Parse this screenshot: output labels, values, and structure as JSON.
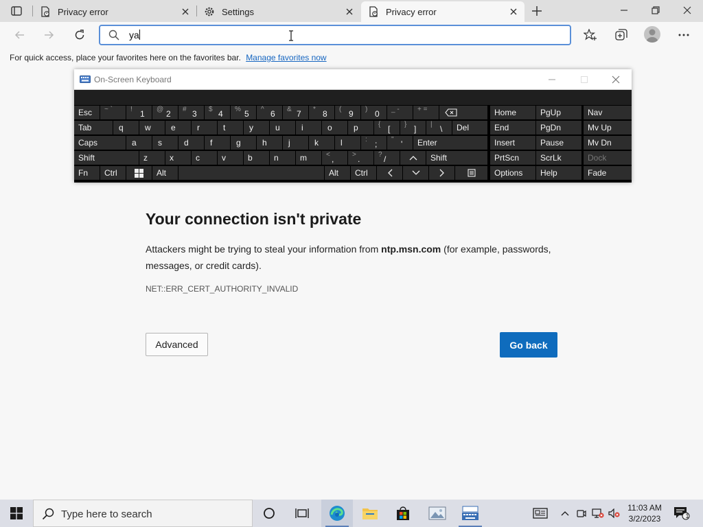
{
  "browser": {
    "tabs": [
      {
        "title": "Privacy error",
        "icon": "page-warning-icon",
        "active": false
      },
      {
        "title": "Settings",
        "icon": "gear-icon",
        "active": false
      },
      {
        "title": "Privacy error",
        "icon": "page-warning-icon",
        "active": true
      }
    ],
    "address_bar": {
      "value": "ya"
    },
    "favorites_bar": {
      "message": "For quick access, place your favorites here on the favorites bar.",
      "link": "Manage favorites now"
    }
  },
  "page": {
    "title": "Your connection isn't private",
    "description_before": "Attackers might be trying to steal your information from ",
    "host": "ntp.msn.com",
    "description_after": " (for example, passwords, messages, or credit cards).",
    "error_code": "NET::ERR_CERT_AUTHORITY_INVALID",
    "advanced_button": "Advanced",
    "back_button": "Go back"
  },
  "osk": {
    "title": "On-Screen Keyboard",
    "keys": {
      "esc": "Esc",
      "tab": "Tab",
      "caps": "Caps",
      "shift": "Shift",
      "fn": "Fn",
      "ctrl": "Ctrl",
      "alt": "Alt",
      "del": "Del",
      "enter": "Enter",
      "home": "Home",
      "pgup": "PgUp",
      "nav": "Nav",
      "end": "End",
      "pgdn": "PgDn",
      "mvup": "Mv Up",
      "insert": "Insert",
      "pause": "Pause",
      "mvdn": "Mv Dn",
      "prtscn": "PrtScn",
      "scrlk": "ScrLk",
      "dock": "Dock",
      "options": "Options",
      "help": "Help",
      "fade": "Fade"
    },
    "row1": [
      [
        "~ `",
        "",
        ""
      ],
      [
        "!",
        "1",
        ""
      ],
      [
        "@",
        "2",
        ""
      ],
      [
        "#",
        "3",
        ""
      ],
      [
        "$",
        "4",
        ""
      ],
      [
        "%",
        "5",
        ""
      ],
      [
        "^",
        "6",
        ""
      ],
      [
        "&",
        "7",
        ""
      ],
      [
        "*",
        "8",
        ""
      ],
      [
        "(",
        "9",
        ""
      ],
      [
        ")",
        "0",
        ""
      ],
      [
        "_ -",
        "",
        ""
      ],
      [
        "+ =",
        "",
        ""
      ]
    ],
    "row2": [
      "q",
      "w",
      "e",
      "r",
      "t",
      "y",
      "u",
      "i",
      "o",
      "p"
    ],
    "row2_sym": [
      [
        "{",
        "["
      ],
      [
        "}",
        "]"
      ],
      [
        "|",
        "\\"
      ]
    ],
    "row3": [
      "a",
      "s",
      "d",
      "f",
      "g",
      "h",
      "j",
      "k",
      "l"
    ],
    "row3_sym": [
      [
        ":",
        ";"
      ],
      [
        "\"",
        "'"
      ]
    ],
    "row4": [
      "z",
      "x",
      "c",
      "v",
      "b",
      "n",
      "m"
    ],
    "row4_sym": [
      [
        "<",
        ","
      ],
      [
        ">",
        "."
      ],
      [
        "?",
        "/"
      ]
    ]
  },
  "taskbar": {
    "search_placeholder": "Type here to search",
    "time": "11:03 AM",
    "date": "3/2/2023",
    "notification_count": "1"
  }
}
